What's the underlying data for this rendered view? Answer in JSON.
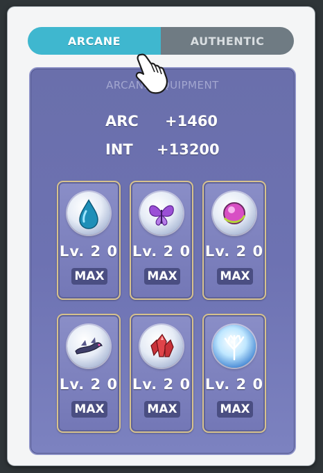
{
  "tabs": [
    {
      "label": "ARCANE",
      "active": true
    },
    {
      "label": "AUTHENTIC",
      "active": false
    }
  ],
  "panel": {
    "title": "ARCANE EQUIPMENT",
    "stats": [
      {
        "label": "ARC",
        "value": "+1460"
      },
      {
        "label": "INT",
        "value": "+13200"
      }
    ]
  },
  "symbols": [
    {
      "icon": "blue-droplet-symbol-icon",
      "level": "Lv. 2 0",
      "max": "MAX"
    },
    {
      "icon": "purple-butterfly-symbol-icon",
      "level": "Lv. 2 0",
      "max": "MAX"
    },
    {
      "icon": "pink-orb-symbol-icon",
      "level": "Lv. 2 0",
      "max": "MAX"
    },
    {
      "icon": "dark-serpent-symbol-icon",
      "level": "Lv. 2 0",
      "max": "MAX"
    },
    {
      "icon": "red-crystal-symbol-icon",
      "level": "Lv. 2 0",
      "max": "MAX"
    },
    {
      "icon": "white-tree-symbol-icon",
      "level": "Lv. 2 0",
      "max": "MAX"
    }
  ],
  "colors": {
    "active_tab": "#3fb7cf",
    "inactive_tab": "#6f7b83",
    "panel": "#6d72b2",
    "card_border": "#d7c28d"
  }
}
